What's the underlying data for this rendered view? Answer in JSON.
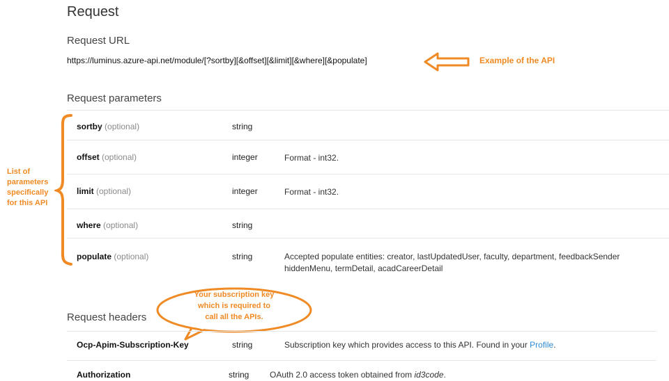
{
  "header": {
    "title": "Request"
  },
  "request_url": {
    "heading": "Request URL",
    "url": "https://luminus.azure-api.net/module/[?sortby][&offset][&limit][&where][&populate]",
    "annotation": "Example of the API"
  },
  "parameters": {
    "heading": "Request parameters",
    "annotation": [
      "List of",
      "parameters",
      "specifically",
      "for this API"
    ],
    "rows": [
      {
        "name": "sortby",
        "optional": "(optional)",
        "type": "string",
        "desc1": "",
        "desc2": ""
      },
      {
        "name": "offset",
        "optional": "(optional)",
        "type": "integer",
        "desc1": "Format - int32.",
        "desc2": ""
      },
      {
        "name": "limit",
        "optional": "(optional)",
        "type": "integer",
        "desc1": "Format - int32.",
        "desc2": ""
      },
      {
        "name": "where",
        "optional": "(optional)",
        "type": "string",
        "desc1": "",
        "desc2": ""
      },
      {
        "name": "populate",
        "optional": "(optional)",
        "type": "string",
        "desc1": "Accepted populate entities: creator, lastUpdatedUser, faculty, department, feedbackSender",
        "desc2": "hiddenMenu, termDetail, acadCareerDetail"
      }
    ]
  },
  "headers": {
    "heading": "Request headers",
    "callout": [
      "Your subscription key",
      "which is required to",
      "call all the APIs."
    ],
    "rows": [
      {
        "name": "Ocp-Apim-Subscription-Key",
        "type": "string",
        "desc_prefix": "Subscription key which provides access to this API. Found in your ",
        "desc_link": "Profile",
        "desc_suffix": "."
      },
      {
        "name": "Authorization",
        "type": "string",
        "desc_prefix": "OAuth 2.0 access token obtained from ",
        "desc_italic": "id3code",
        "desc_suffix": "."
      }
    ]
  },
  "colors": {
    "annotation": "#f08a24",
    "link": "#2e8bd3"
  }
}
